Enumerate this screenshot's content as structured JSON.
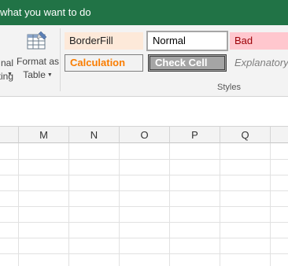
{
  "titlebar": {
    "tell_me": "what you want to do"
  },
  "ribbon": {
    "conditional_formatting": {
      "line1": "nal",
      "line2": "ting"
    },
    "format_as_table": {
      "line1": "Format as",
      "line2": "Table"
    },
    "cell_styles": [
      {
        "name": "BorderFill"
      },
      {
        "name": "Normal"
      },
      {
        "name": "Bad"
      },
      {
        "name": "Calculation"
      },
      {
        "name": "Check Cell"
      },
      {
        "name": "Explanatory"
      }
    ],
    "group_label": "Styles"
  },
  "grid": {
    "columns": [
      "M",
      "N",
      "O",
      "P",
      "Q"
    ]
  },
  "colors": {
    "titlebar": "#217346",
    "ribbon": "#f3f3f3"
  }
}
